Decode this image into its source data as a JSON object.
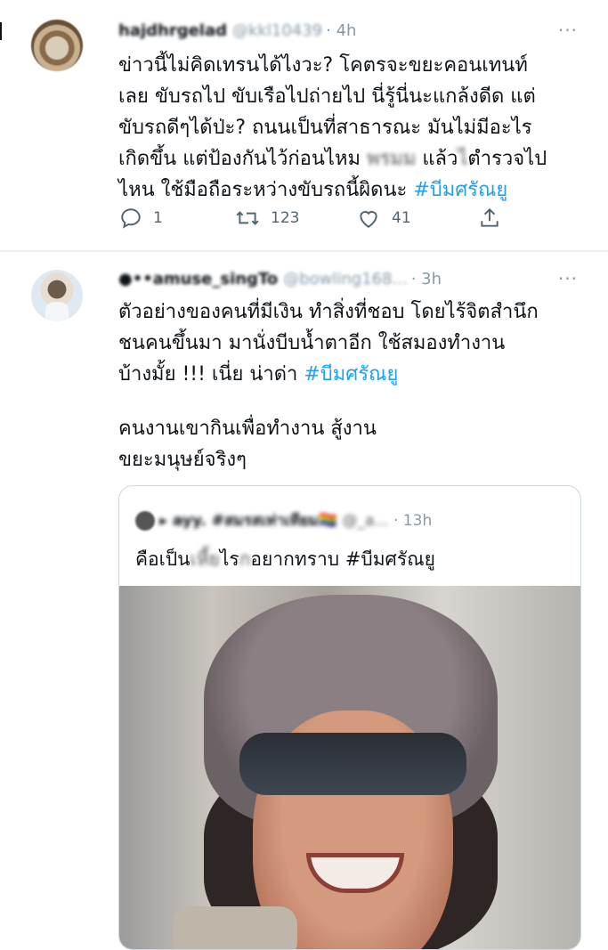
{
  "tweet1": {
    "name": "hajdhrgelad",
    "handle": "@kkl10439",
    "time": "· 4h",
    "more": "···",
    "text": "ข่าวนี้ไม่คิดเทรนได้ไงวะ? โคตรจะขยะคอนเทนท์\nเลย ขับรถไป ขับเรือไปถ่ายไป นี่รู้นี่นะแกล้งดีด แต่\nขับรถดีๆได้ป่ะ? ถนนเป็นที่สาธารณะ มันไม่มีอะไร\nเกิดขึ้น แต่ป้องกันไว้ก่อนไหม ",
    "blurred1": "พรมม",
    "text2": " แล้ว",
    "blurred2": "ไ",
    "text3": "ตำรวจไป\nไหน ใช้มือถือระหว่างขับรถนี้ผิดนะ ",
    "hashtag": "#บีมศรัณยู",
    "reply_count": "1",
    "retweet_count": "123",
    "like_count": "41"
  },
  "tweet2": {
    "name": "●••amuse_singTo",
    "handle": "@bowling168...",
    "time": "· 3h",
    "more": "···",
    "text": "ตัวอย่างของคนที่มีเงิน ทำสิ่งที่ชอบ โดยไร้จิตสำนึก\nชนคนขึ้นมา มานั่งบีบน้ำตาอีก  ใช้สมองทำงาน\nบ้างมั้ย !!! เนี่ย น่าด่า  ",
    "hashtag": "#บีมศรัณยู",
    "text_after": "คนงานเขากินเพื่อทำงาน สู้งาน\nขยะมนุษย์จริงๆ"
  },
  "quote": {
    "name": "▸ ayy. #สมรสเท่าเทียม🏳️‍🌈",
    "handle": "@_a...",
    "time": "· 13h",
    "text_before": "คือเป็น",
    "blurred1": "เหี้ย",
    "text_mid": "ไร",
    "blurred2": "ก",
    "text_after": "อยากทราบ ",
    "hashtag": "#บีมศรัณยู"
  },
  "icons": [
    "reply-icon",
    "retweet-icon",
    "like-icon",
    "share-icon"
  ],
  "colors": {
    "hashtag": "#1da1f2",
    "meta": "#8899a6",
    "divider": "#eceff1"
  }
}
